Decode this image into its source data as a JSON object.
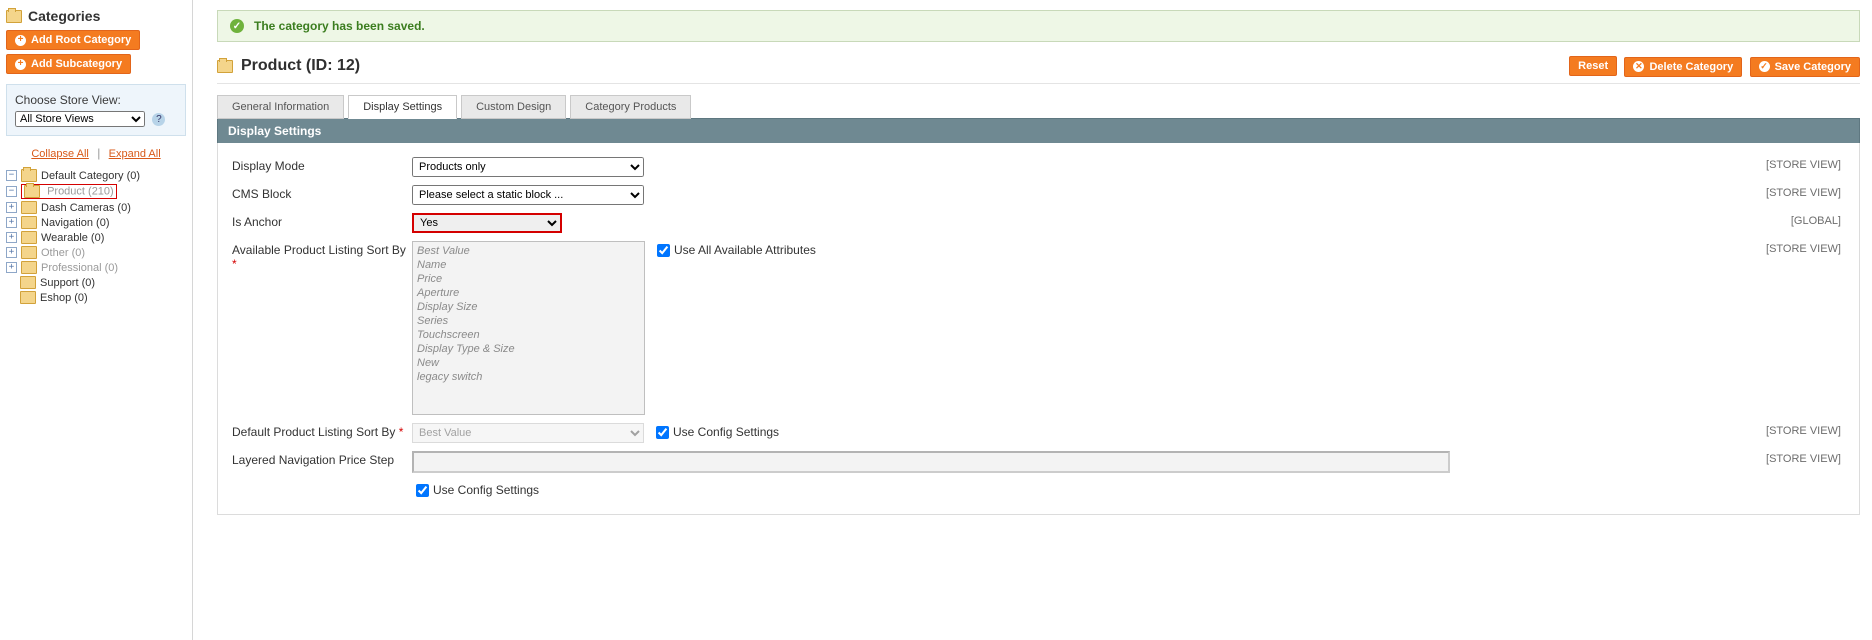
{
  "sidebar": {
    "title": "Categories",
    "add_root_label": "Add Root Category",
    "add_sub_label": "Add Subcategory",
    "choose_store_label": "Choose Store View:",
    "store_select_value": "All Store Views",
    "collapse_label": "Collapse All",
    "expand_label": "Expand All",
    "tree": {
      "root": "Default Category (0)",
      "product": "Product (210)",
      "dash": "Dash Cameras (0)",
      "navigation": "Navigation (0)",
      "wearable": "Wearable (0)",
      "other": "Other (0)",
      "professional": "Professional (0)",
      "support": "Support (0)",
      "eshop": "Eshop (0)"
    }
  },
  "message": {
    "success": "The category has been saved."
  },
  "header": {
    "title": "Product (ID: 12)",
    "reset": "Reset",
    "delete": "Delete Category",
    "save": "Save Category"
  },
  "tabs": {
    "general": "General Information",
    "display": "Display Settings",
    "custom": "Custom Design",
    "products": "Category Products"
  },
  "panel": {
    "title": "Display Settings",
    "display_mode_label": "Display Mode",
    "display_mode_value": "Products only",
    "cms_block_label": "CMS Block",
    "cms_block_value": "Please select a static block ...",
    "is_anchor_label": "Is Anchor",
    "is_anchor_value": "Yes",
    "sort_by_label": "Available Product Listing Sort By",
    "sort_options": [
      "Best Value",
      "Name",
      "Price",
      "Aperture",
      "Display Size",
      "Series",
      "Touchscreen",
      "Display Type & Size",
      "New",
      "legacy switch"
    ],
    "use_all_label": "Use All Available Attributes",
    "default_sort_label": "Default Product Listing Sort By",
    "default_sort_value": "Best Value",
    "use_config_label": "Use Config Settings",
    "price_step_label": "Layered Navigation Price Step",
    "use_config_label2": "Use Config Settings",
    "scope_store": "[STORE VIEW]",
    "scope_global": "[GLOBAL]"
  }
}
